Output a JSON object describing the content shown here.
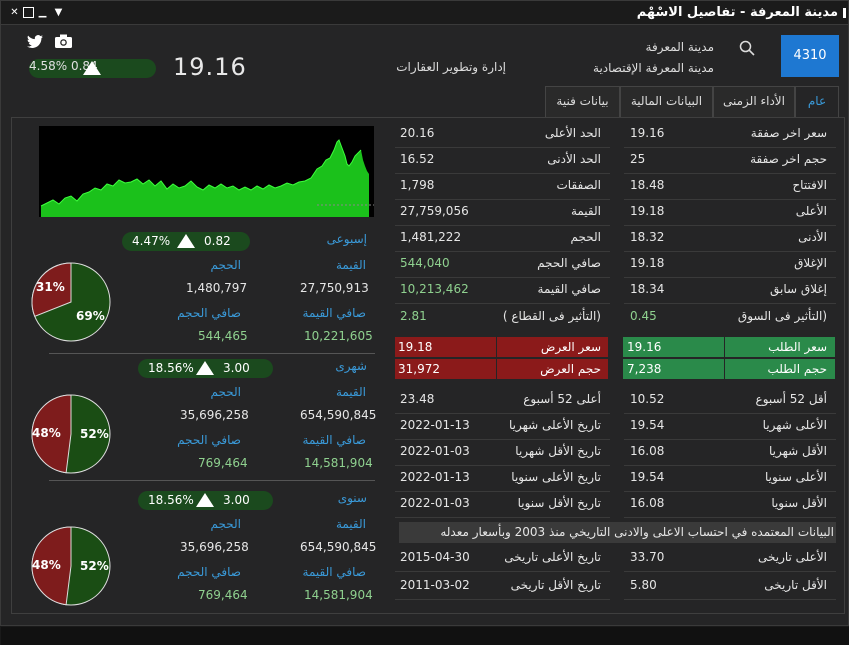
{
  "window": {
    "title": "مدينة المعرفة - تفاصيل الاسْهْم"
  },
  "header": {
    "symbol": "4310",
    "name_short": "مدينة المعرفة",
    "name_long": "مدينة المعرفة الإقتصادية",
    "sector": "إدارة وتطوير العقارات",
    "price": "19.16",
    "change": "0.84",
    "change_pct": "4.58%"
  },
  "tabs": [
    {
      "label": "عام"
    },
    {
      "label": "الأداء الزمنى"
    },
    {
      "label": "البيانات المالية"
    },
    {
      "label": "بيانات فنية"
    }
  ],
  "right_col": [
    {
      "label": "سعر اخر صفقة",
      "value": "19.16"
    },
    {
      "label": "حجم اخر صفقة",
      "value": "25"
    },
    {
      "label": "الافتتاح",
      "value": "18.48"
    },
    {
      "label": "الأعلى",
      "value": "19.18"
    },
    {
      "label": "الأدنى",
      "value": "18.32"
    },
    {
      "label": "الإغلاق",
      "value": "19.18"
    },
    {
      "label": "إغلاق سابق",
      "value": "18.34"
    },
    {
      "label": "(التأثير فى السوق",
      "value": "0.45"
    }
  ],
  "mid_col": [
    {
      "label": "الحد الأعلى",
      "value": "20.16"
    },
    {
      "label": "الحد الأدنى",
      "value": "16.52"
    },
    {
      "label": "الصفقات",
      "value": "1,798"
    },
    {
      "label": "القيمة",
      "value": "27,759,056"
    },
    {
      "label": "الحجم",
      "value": "1,481,222"
    },
    {
      "label": "صافي الحجم",
      "value": "544,040"
    },
    {
      "label": "صافي القيمة",
      "value": "10,213,462"
    },
    {
      "label": "(التأثير فى القطاع )",
      "value": "2.81"
    }
  ],
  "orderbook": {
    "bid_price_label": "سعر الطلب",
    "bid_price": "19.16",
    "bid_vol_label": "حجم الطلب",
    "bid_vol": "7,238",
    "ask_price_label": "سعر العرض",
    "ask_price": "19.18",
    "ask_vol_label": "حجم العرض",
    "ask_vol": "31,972"
  },
  "right_hist": [
    {
      "label": "أقل 52 أسبوع",
      "value": "10.52"
    },
    {
      "label": "الأعلى شهريا",
      "value": "19.54"
    },
    {
      "label": "الأقل شهريا",
      "value": "16.08"
    },
    {
      "label": "الأعلى سنويا",
      "value": "19.54"
    },
    {
      "label": "الأقل سنويا",
      "value": "16.08"
    }
  ],
  "mid_hist": [
    {
      "label": "أعلى 52 أسبوع",
      "value": "23.48"
    },
    {
      "label": "تاريخ الأعلى شهريا",
      "value": "2022-01-13"
    },
    {
      "label": "تاريخ الأقل شهريا",
      "value": "2022-01-03"
    },
    {
      "label": "تاريخ الأعلى سنويا",
      "value": "2022-01-13"
    },
    {
      "label": "تاريخ الأقل سنويا",
      "value": "2022-01-03"
    }
  ],
  "note": "البيانات المعتمده في احتساب الاعلى والادنى التاريخي منذ  2003  وبأسعار معدله",
  "historic": [
    {
      "rlabel": "الأعلى تاريخى",
      "rvalue": "33.70",
      "mlabel": "تاريخ الأعلى تاريخى",
      "mvalue": "2015-04-30"
    },
    {
      "rlabel": "الأقل تاريخى",
      "rvalue": "5.80",
      "mlabel": "تاريخ الأقل تاريخى",
      "mvalue": "2011-03-02"
    }
  ],
  "periods": [
    {
      "name": "إسبوعى",
      "change": "0.82",
      "change_pct": "4.47%",
      "value_label": "القيمة",
      "volume_label": "الحجم",
      "net_value_label": "صافي القيمة",
      "net_volume_label": "صافي الحجم",
      "value": "27,750,913",
      "volume": "1,480,797",
      "net_value": "10,221,605",
      "net_volume": "544,465",
      "pie_red": "31%",
      "pie_green": "69%",
      "red_frac": 0.31
    },
    {
      "name": "شهرى",
      "change": "3.00",
      "change_pct": "18.56%",
      "value_label": "القيمة",
      "volume_label": "الحجم",
      "net_value_label": "صافي القيمة",
      "net_volume_label": "صافي الحجم",
      "value": "654,590,845",
      "volume": "35,696,258",
      "net_value": "14,581,904",
      "net_volume": "769,464",
      "pie_red": "48%",
      "pie_green": "52%",
      "red_frac": 0.48
    },
    {
      "name": "سنوى",
      "change": "3.00",
      "change_pct": "18.56%",
      "value_label": "القيمة",
      "volume_label": "الحجم",
      "net_value_label": "صافي القيمة",
      "net_volume_label": "صافي الحجم",
      "value": "654,590,845",
      "volume": "35,696,258",
      "net_value": "14,581,904",
      "net_volume": "769,464",
      "pie_red": "48%",
      "pie_green": "52%",
      "red_frac": 0.48
    }
  ],
  "colors": {
    "accent": "#1e78d2",
    "up": "#2ecc40",
    "down": "#8b1a1a"
  }
}
